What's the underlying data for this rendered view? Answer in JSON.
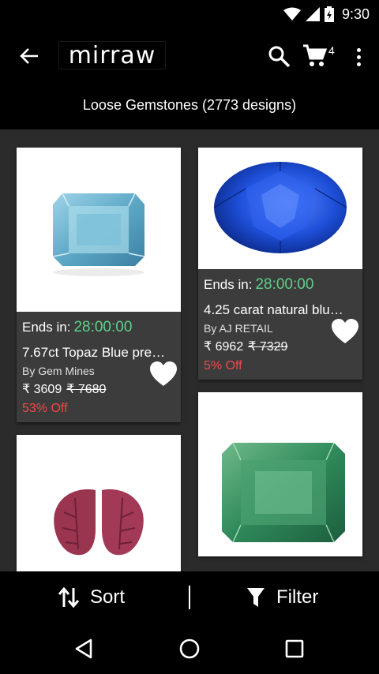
{
  "status_bar": {
    "time": "9:30"
  },
  "app_bar": {
    "logo": "mirraw",
    "cart_count": "4"
  },
  "header": {
    "title": "Loose Gemstones (2773 designs)"
  },
  "products": [
    {
      "ends_label": "Ends in:",
      "ends_time": "28:00:00",
      "title": "7.67ct Topaz Blue pre…",
      "seller": "By Gem Mines",
      "price": "₹ 3609",
      "old_price": "₹ 7680",
      "discount": "53% Off",
      "image_icon": "topaz-gem"
    },
    {
      "ends_label": "Ends in:",
      "ends_time": "28:00:00",
      "title": "4.25 carat natural blu…",
      "seller": "By AJ RETAIL",
      "price": "₹ 6962",
      "old_price": "₹ 7329",
      "discount": "5% Off",
      "image_icon": "blue-sapphire-gem"
    },
    {
      "image_icon": "carved-ruby-gem"
    },
    {
      "image_icon": "emerald-gem"
    }
  ],
  "bottom_bar": {
    "sort_label": "Sort",
    "filter_label": "Filter"
  },
  "colors": {
    "timer": "#5ed08a",
    "discount": "#f04848",
    "card": "#3c3c3c",
    "background": "#2b2b2b"
  }
}
